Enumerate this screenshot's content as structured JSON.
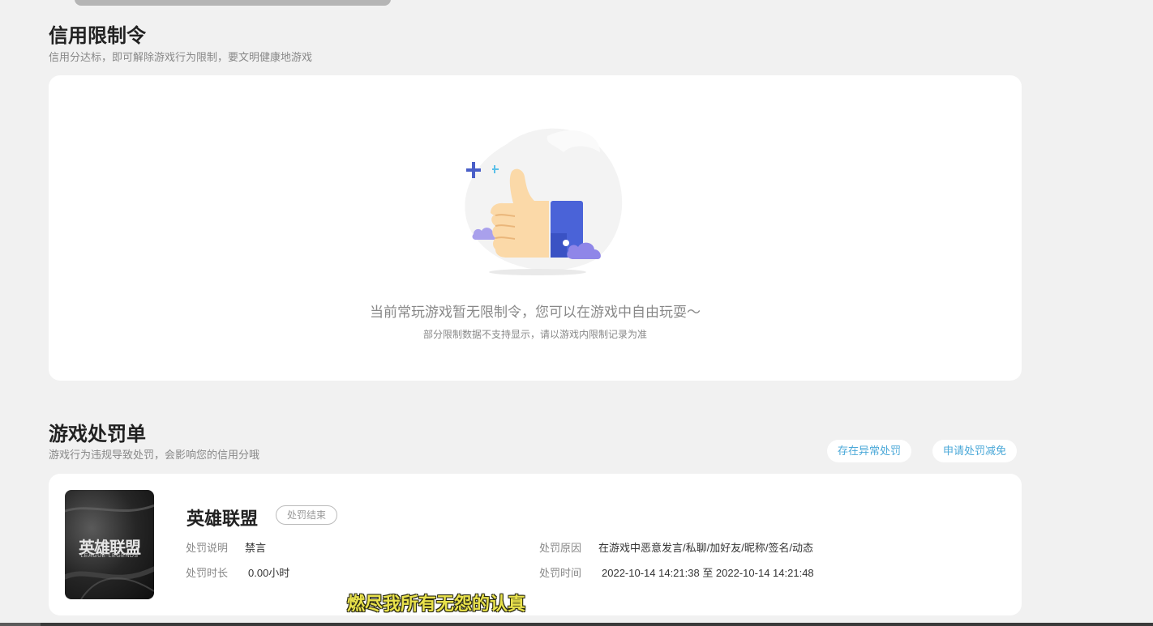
{
  "credit": {
    "title": "信用限制令",
    "subtitle": "信用分达标，即可解除游戏行为限制，要文明健康地游戏",
    "empty_main": "当前常玩游戏暂无限制令，您可以在游戏中自由玩耍～",
    "empty_sub": "部分限制数据不支持显示，请以游戏内限制记录为准"
  },
  "penalty": {
    "title": "游戏处罚单",
    "subtitle": "游戏行为违规导致处罚，会影响您的信用分哦",
    "btn_abnormal": "存在异常处罚",
    "btn_reduce": "申请处罚减免",
    "record": {
      "thumb_cn": "英雄联盟",
      "thumb_en": "LEAGUE·LEGENDS",
      "game_name": "英雄联盟",
      "status": "处罚结束",
      "desc_label": "处罚说明",
      "desc_value": "禁言",
      "duration_label": "处罚时长",
      "duration_value": "0.00小时",
      "reason_label": "处罚原因",
      "reason_value": "在游戏中恶意发言/私聊/加好友/昵称/签名/动态",
      "time_label": "处罚时间",
      "time_value": "2022-10-14 14:21:38 至 2022-10-14 14:21:48"
    }
  },
  "caption": "燃尽我所有无怨的认真",
  "colors": {
    "background": "#f1f1f1",
    "card": "#ffffff",
    "link": "#4aa8d8",
    "thumb_blue": "#4a63d8",
    "caption_yellow": "#e9e24c"
  }
}
